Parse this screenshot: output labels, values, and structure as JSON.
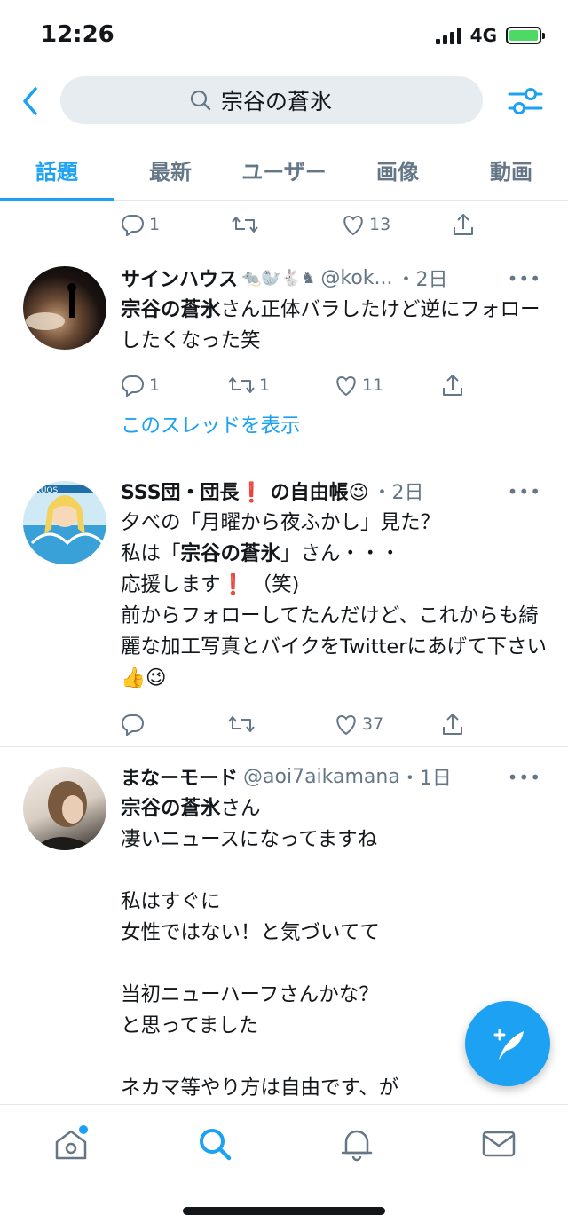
{
  "status": {
    "time": "12:26",
    "network": "4G"
  },
  "search": {
    "query": "宗谷の蒼氷"
  },
  "tabs": [
    {
      "label": "話題",
      "active": true
    },
    {
      "label": "最新"
    },
    {
      "label": "ユーザー"
    },
    {
      "label": "画像"
    },
    {
      "label": "動画"
    }
  ],
  "partial_tweet": {
    "reply": "1",
    "retweet": "",
    "like": "13"
  },
  "tweets": [
    {
      "name": "サインハウス",
      "name_emoji": "🐀🦭🐇♞",
      "handle": "@kok...",
      "time": "・2日",
      "body_bold": "宗谷の蒼氷",
      "body_rest": "さん正体バラしたけど逆にフォローしたくなった笑",
      "reply": "1",
      "retweet": "1",
      "like": "11",
      "thread": "このスレッドを表示"
    },
    {
      "name": "SSS団・団長❗ の自由帳😉",
      "handle": "",
      "time": "・2日",
      "line1": "夕べの「月曜から夜ふかし」見た？",
      "line2a": "私は「",
      "line2b": "宗谷の蒼氷",
      "line2c": "」さん・・・",
      "line3": "応援します❗ （笑)",
      "line4": "前からフォローしてたんだけど、これからも綺麗な加工写真とバイクをTwitterにあげて下さい👍😉",
      "reply": "",
      "retweet": "",
      "like": "37"
    },
    {
      "name": "まなーモード",
      "handle": "@aoi7aikamana",
      "time": "・1日",
      "body_bold": "宗谷の蒼氷",
      "body_rest": "さん",
      "line2": "凄いニュースになってますね",
      "line3": "私はすぐに",
      "line4": "女性ではない！と気づいてて",
      "line5": "当初ニューハーフさんかな？",
      "line6": "と思ってました",
      "line7": "ネカマ等やり方は自由です、が"
    }
  ],
  "colors": {
    "accent": "#1da1f2",
    "text": "#14171a",
    "muted": "#657786",
    "divider": "#e1e8ed"
  }
}
